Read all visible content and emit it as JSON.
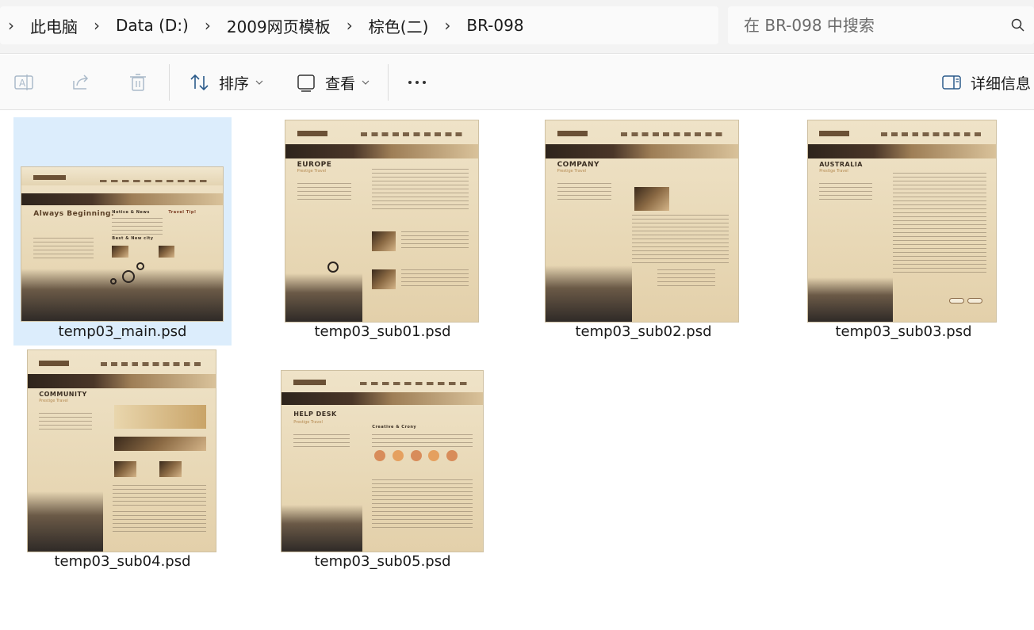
{
  "breadcrumb": {
    "items": [
      "此电脑",
      "Data (D:)",
      "2009网页模板",
      "棕色(二)",
      "BR-098"
    ]
  },
  "search": {
    "placeholder": "在 BR-098 中搜索"
  },
  "toolbar": {
    "sort_label": "排序",
    "view_label": "查看",
    "details_label": "详细信息"
  },
  "files": [
    {
      "name": "temp03_main.psd",
      "selected": true,
      "heading": "Always Beginning."
    },
    {
      "name": "temp03_sub01.psd",
      "selected": false,
      "heading": "EUROPE"
    },
    {
      "name": "temp03_sub02.psd",
      "selected": false,
      "heading": "COMPANY"
    },
    {
      "name": "temp03_sub03.psd",
      "selected": false,
      "heading": "AUSTRALIA"
    },
    {
      "name": "temp03_sub04.psd",
      "selected": false,
      "heading": "COMMUNITY"
    },
    {
      "name": "temp03_sub05.psd",
      "selected": false,
      "heading": "HELP DESK"
    }
  ],
  "thumb_texts": {
    "main_notice": "Notice & News",
    "main_travel": "Travel Tip!",
    "main_best": "Best & New city",
    "sub_tagline": "Prestige Travel",
    "sub05_creative": "Creative & Crony"
  }
}
